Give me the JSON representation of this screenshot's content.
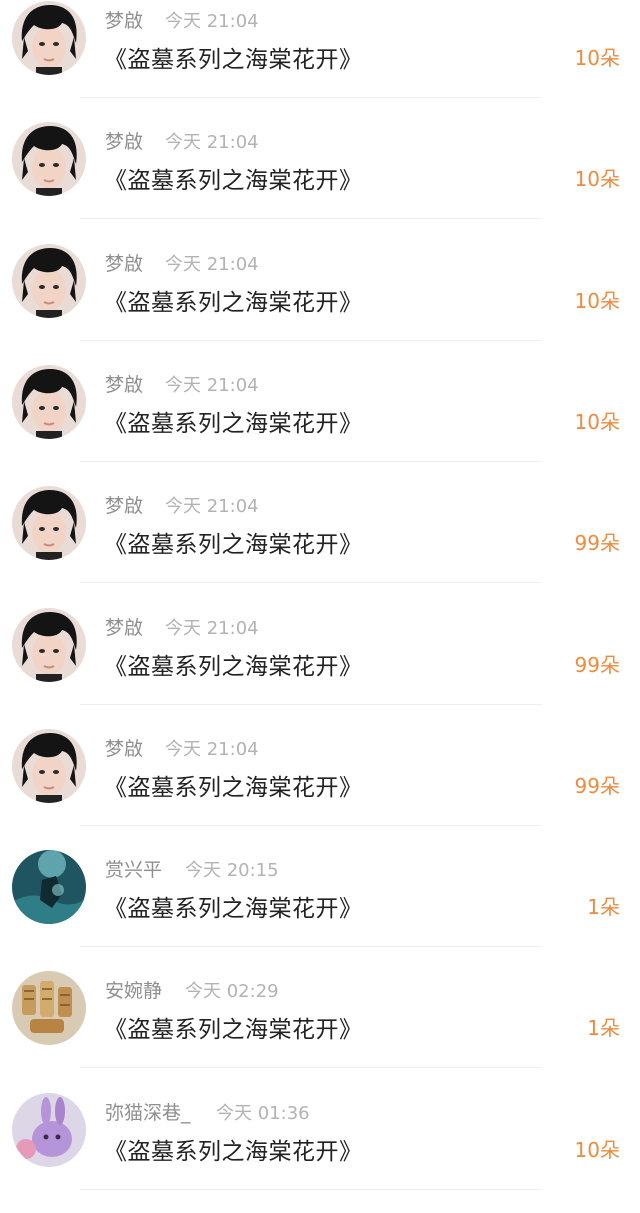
{
  "colors": {
    "count": "#f08a3c",
    "name": "#8f8f8f",
    "time": "#b3b3b3",
    "title": "#222222"
  },
  "gifts": [
    {
      "user": "梦啟",
      "time": "今天 21:04",
      "title": "《盗墓系列之海棠花开》",
      "count": "10朵",
      "avatar": "boy-portrait"
    },
    {
      "user": "梦啟",
      "time": "今天 21:04",
      "title": "《盗墓系列之海棠花开》",
      "count": "10朵",
      "avatar": "boy-portrait"
    },
    {
      "user": "梦啟",
      "time": "今天 21:04",
      "title": "《盗墓系列之海棠花开》",
      "count": "10朵",
      "avatar": "boy-portrait"
    },
    {
      "user": "梦啟",
      "time": "今天 21:04",
      "title": "《盗墓系列之海棠花开》",
      "count": "10朵",
      "avatar": "boy-portrait"
    },
    {
      "user": "梦啟",
      "time": "今天 21:04",
      "title": "《盗墓系列之海棠花开》",
      "count": "99朵",
      "avatar": "boy-portrait"
    },
    {
      "user": "梦啟",
      "time": "今天 21:04",
      "title": "《盗墓系列之海棠花开》",
      "count": "99朵",
      "avatar": "boy-portrait"
    },
    {
      "user": "梦啟",
      "time": "今天 21:04",
      "title": "《盗墓系列之海棠花开》",
      "count": "99朵",
      "avatar": "boy-portrait"
    },
    {
      "user": "赏兴平",
      "time": "今天 20:15",
      "title": "《盗墓系列之海棠花开》",
      "count": "1朵",
      "avatar": "teal-scene"
    },
    {
      "user": "安婉静",
      "time": "今天 02:29",
      "title": "《盗墓系列之海棠花开》",
      "count": "1朵",
      "avatar": "wooden-cylinders"
    },
    {
      "user": "弥猫深巷_",
      "time": "今天 01:36",
      "title": "《盗墓系列之海棠花开》",
      "count": "10朵",
      "avatar": "purple-plush"
    }
  ]
}
